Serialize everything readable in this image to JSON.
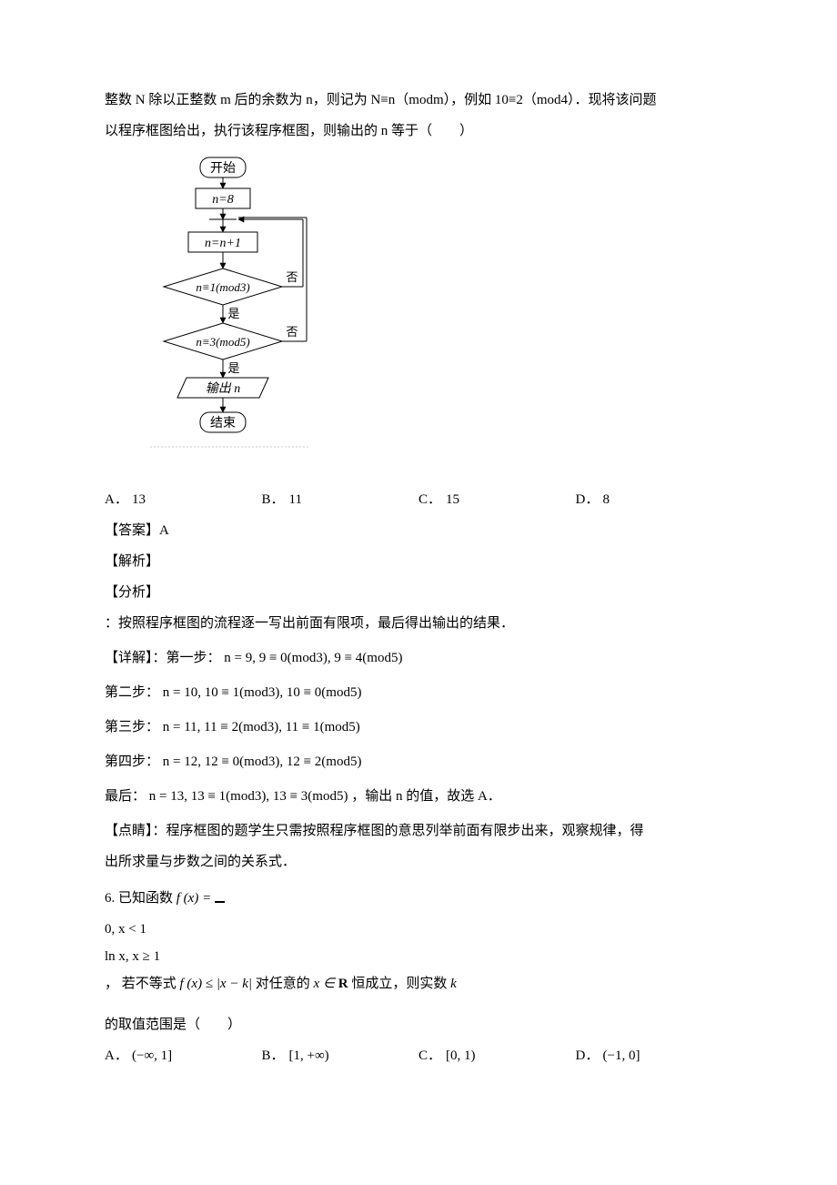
{
  "intro": {
    "line1": "整数 N 除以正整数 m 后的余数为 n，则记为 N≡n（modm），例如 10≡2（mod4）．现将该问题",
    "line2": "以程序框图给出，执行该程序框图，则输出的 n 等于（　　）"
  },
  "flowchart": {
    "start": "开始",
    "init": "n=8",
    "incr": "n=n+1",
    "cond1": "n≡1(mod3)",
    "cond2": "n≡3(mod5)",
    "yes": "是",
    "no": "否",
    "output": "输出 n",
    "end": "结束"
  },
  "q5_options": {
    "a_label": "A．",
    "a_text": "13",
    "b_label": "B．",
    "b_text": "11",
    "c_label": "C．",
    "c_text": "15",
    "d_label": "D．",
    "d_text": "8"
  },
  "solution5": {
    "answer": "【答案】A",
    "jiexi": "【解析】",
    "fenxi": "【分析】",
    "fenxi_text": "：按照程序框图的流程逐一写出前面有限项，最后得出输出的结果．",
    "xj_prefix": "【详解】：第一步：",
    "step1": "n = 9, 9 ≡ 0(mod3), 9 ≡ 4(mod5)",
    "step2_prefix": "第二步：",
    "step2": "n = 10, 10 ≡ 1(mod3), 10 ≡ 0(mod5)",
    "step3_prefix": "第三步：",
    "step3": "n = 11, 11 ≡ 2(mod3), 11 ≡ 1(mod5)",
    "step4_prefix": "第四步：",
    "step4": "n = 12, 12 ≡ 0(mod3), 12 ≡ 2(mod5)",
    "stepF_prefix": "最后：",
    "stepF": "n = 13, 13 ≡ 1(mod3), 13 ≡ 3(mod5)",
    "stepF_suffix": "，输出 n 的值，故选 A．",
    "dj_line1": "【点睛】：程序框图的题学生只需按照程序框图的意思列举前面有限步出来，观察规律，得",
    "dj_line2": "出所求量与步数之间的关系式．"
  },
  "q6": {
    "prefix": "6. 已知函数 ",
    "fx": "f (x) = ",
    "piece1": "0,  x < 1",
    "piece2": "ln x,  x ≥ 1",
    "mid": "， 若不等式 ",
    "ineq": "f (x) ≤ |x − k|",
    "mid2": " 对任意的 ",
    "xin": "x ∈ R",
    "mid3": " 恒成立，则实数 ",
    "kvar": "k",
    "line2": "的取值范围是（　　）"
  },
  "q6_options": {
    "a_label": "A．",
    "a_text": "(−∞, 1]",
    "b_label": "B．",
    "b_text": "[1, +∞)",
    "c_label": "C．",
    "c_text": "[0, 1)",
    "d_label": "D．",
    "d_text": "(−1, 0]"
  }
}
